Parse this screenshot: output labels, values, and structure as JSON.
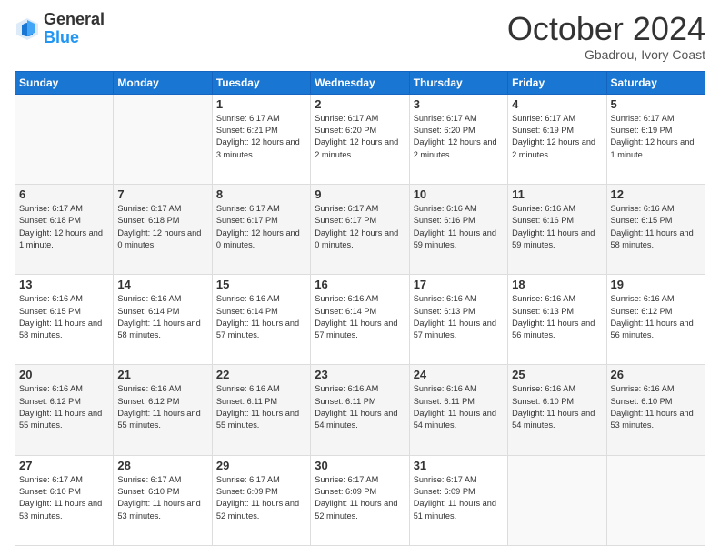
{
  "header": {
    "logo_general": "General",
    "logo_blue": "Blue",
    "month_title": "October 2024",
    "location": "Gbadrou, Ivory Coast"
  },
  "weekdays": [
    "Sunday",
    "Monday",
    "Tuesday",
    "Wednesday",
    "Thursday",
    "Friday",
    "Saturday"
  ],
  "weeks": [
    [
      {
        "day": "",
        "sunrise": "",
        "sunset": "",
        "daylight": ""
      },
      {
        "day": "",
        "sunrise": "",
        "sunset": "",
        "daylight": ""
      },
      {
        "day": "1",
        "sunrise": "Sunrise: 6:17 AM",
        "sunset": "Sunset: 6:21 PM",
        "daylight": "Daylight: 12 hours and 3 minutes."
      },
      {
        "day": "2",
        "sunrise": "Sunrise: 6:17 AM",
        "sunset": "Sunset: 6:20 PM",
        "daylight": "Daylight: 12 hours and 2 minutes."
      },
      {
        "day": "3",
        "sunrise": "Sunrise: 6:17 AM",
        "sunset": "Sunset: 6:20 PM",
        "daylight": "Daylight: 12 hours and 2 minutes."
      },
      {
        "day": "4",
        "sunrise": "Sunrise: 6:17 AM",
        "sunset": "Sunset: 6:19 PM",
        "daylight": "Daylight: 12 hours and 2 minutes."
      },
      {
        "day": "5",
        "sunrise": "Sunrise: 6:17 AM",
        "sunset": "Sunset: 6:19 PM",
        "daylight": "Daylight: 12 hours and 1 minute."
      }
    ],
    [
      {
        "day": "6",
        "sunrise": "Sunrise: 6:17 AM",
        "sunset": "Sunset: 6:18 PM",
        "daylight": "Daylight: 12 hours and 1 minute."
      },
      {
        "day": "7",
        "sunrise": "Sunrise: 6:17 AM",
        "sunset": "Sunset: 6:18 PM",
        "daylight": "Daylight: 12 hours and 0 minutes."
      },
      {
        "day": "8",
        "sunrise": "Sunrise: 6:17 AM",
        "sunset": "Sunset: 6:17 PM",
        "daylight": "Daylight: 12 hours and 0 minutes."
      },
      {
        "day": "9",
        "sunrise": "Sunrise: 6:17 AM",
        "sunset": "Sunset: 6:17 PM",
        "daylight": "Daylight: 12 hours and 0 minutes."
      },
      {
        "day": "10",
        "sunrise": "Sunrise: 6:16 AM",
        "sunset": "Sunset: 6:16 PM",
        "daylight": "Daylight: 11 hours and 59 minutes."
      },
      {
        "day": "11",
        "sunrise": "Sunrise: 6:16 AM",
        "sunset": "Sunset: 6:16 PM",
        "daylight": "Daylight: 11 hours and 59 minutes."
      },
      {
        "day": "12",
        "sunrise": "Sunrise: 6:16 AM",
        "sunset": "Sunset: 6:15 PM",
        "daylight": "Daylight: 11 hours and 58 minutes."
      }
    ],
    [
      {
        "day": "13",
        "sunrise": "Sunrise: 6:16 AM",
        "sunset": "Sunset: 6:15 PM",
        "daylight": "Daylight: 11 hours and 58 minutes."
      },
      {
        "day": "14",
        "sunrise": "Sunrise: 6:16 AM",
        "sunset": "Sunset: 6:14 PM",
        "daylight": "Daylight: 11 hours and 58 minutes."
      },
      {
        "day": "15",
        "sunrise": "Sunrise: 6:16 AM",
        "sunset": "Sunset: 6:14 PM",
        "daylight": "Daylight: 11 hours and 57 minutes."
      },
      {
        "day": "16",
        "sunrise": "Sunrise: 6:16 AM",
        "sunset": "Sunset: 6:14 PM",
        "daylight": "Daylight: 11 hours and 57 minutes."
      },
      {
        "day": "17",
        "sunrise": "Sunrise: 6:16 AM",
        "sunset": "Sunset: 6:13 PM",
        "daylight": "Daylight: 11 hours and 57 minutes."
      },
      {
        "day": "18",
        "sunrise": "Sunrise: 6:16 AM",
        "sunset": "Sunset: 6:13 PM",
        "daylight": "Daylight: 11 hours and 56 minutes."
      },
      {
        "day": "19",
        "sunrise": "Sunrise: 6:16 AM",
        "sunset": "Sunset: 6:12 PM",
        "daylight": "Daylight: 11 hours and 56 minutes."
      }
    ],
    [
      {
        "day": "20",
        "sunrise": "Sunrise: 6:16 AM",
        "sunset": "Sunset: 6:12 PM",
        "daylight": "Daylight: 11 hours and 55 minutes."
      },
      {
        "day": "21",
        "sunrise": "Sunrise: 6:16 AM",
        "sunset": "Sunset: 6:12 PM",
        "daylight": "Daylight: 11 hours and 55 minutes."
      },
      {
        "day": "22",
        "sunrise": "Sunrise: 6:16 AM",
        "sunset": "Sunset: 6:11 PM",
        "daylight": "Daylight: 11 hours and 55 minutes."
      },
      {
        "day": "23",
        "sunrise": "Sunrise: 6:16 AM",
        "sunset": "Sunset: 6:11 PM",
        "daylight": "Daylight: 11 hours and 54 minutes."
      },
      {
        "day": "24",
        "sunrise": "Sunrise: 6:16 AM",
        "sunset": "Sunset: 6:11 PM",
        "daylight": "Daylight: 11 hours and 54 minutes."
      },
      {
        "day": "25",
        "sunrise": "Sunrise: 6:16 AM",
        "sunset": "Sunset: 6:10 PM",
        "daylight": "Daylight: 11 hours and 54 minutes."
      },
      {
        "day": "26",
        "sunrise": "Sunrise: 6:16 AM",
        "sunset": "Sunset: 6:10 PM",
        "daylight": "Daylight: 11 hours and 53 minutes."
      }
    ],
    [
      {
        "day": "27",
        "sunrise": "Sunrise: 6:17 AM",
        "sunset": "Sunset: 6:10 PM",
        "daylight": "Daylight: 11 hours and 53 minutes."
      },
      {
        "day": "28",
        "sunrise": "Sunrise: 6:17 AM",
        "sunset": "Sunset: 6:10 PM",
        "daylight": "Daylight: 11 hours and 53 minutes."
      },
      {
        "day": "29",
        "sunrise": "Sunrise: 6:17 AM",
        "sunset": "Sunset: 6:09 PM",
        "daylight": "Daylight: 11 hours and 52 minutes."
      },
      {
        "day": "30",
        "sunrise": "Sunrise: 6:17 AM",
        "sunset": "Sunset: 6:09 PM",
        "daylight": "Daylight: 11 hours and 52 minutes."
      },
      {
        "day": "31",
        "sunrise": "Sunrise: 6:17 AM",
        "sunset": "Sunset: 6:09 PM",
        "daylight": "Daylight: 11 hours and 51 minutes."
      },
      {
        "day": "",
        "sunrise": "",
        "sunset": "",
        "daylight": ""
      },
      {
        "day": "",
        "sunrise": "",
        "sunset": "",
        "daylight": ""
      }
    ]
  ]
}
